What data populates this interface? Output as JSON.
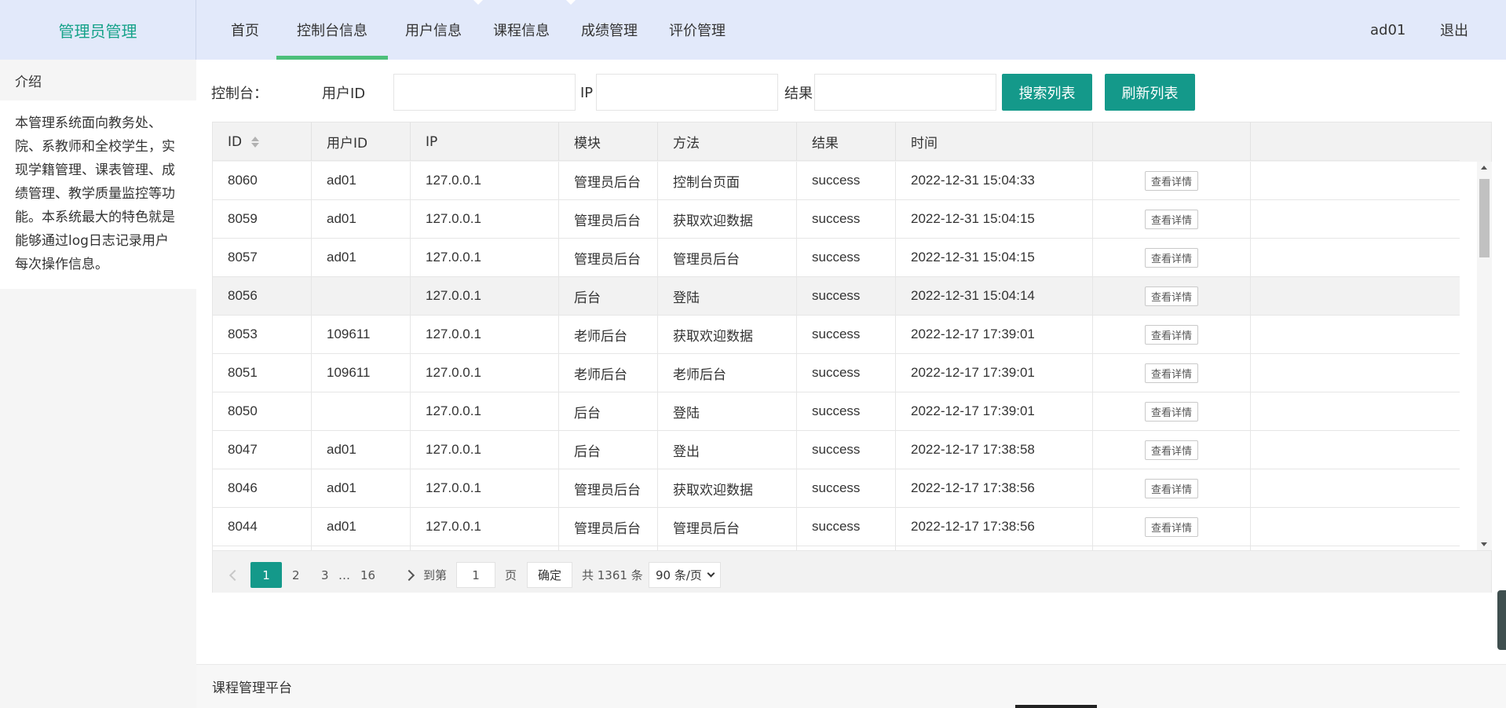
{
  "header": {
    "brand": "管理员管理",
    "nav": [
      "首页",
      "控制台信息",
      "用户信息",
      "课程信息",
      "成绩管理",
      "评价管理"
    ],
    "active_nav": "控制台信息",
    "user": "ad01",
    "logout": "退出"
  },
  "sidebar": {
    "title": "介绍",
    "text": "本管理系统面向教务处、院、系教师和全校学生，实现学籍管理、课表管理、成绩管理、教学质量监控等功能。本系统最大的特色就是能够通过log日志记录用户每次操作信息。"
  },
  "search": {
    "prefix": "控制台：",
    "user_id_label": "用户ID",
    "ip_label": "IP",
    "result_label": "结果",
    "user_id_value": "",
    "ip_value": "",
    "result_value": "",
    "search_button": "搜索列表",
    "refresh_button": "刷新列表"
  },
  "table": {
    "headers": [
      "ID",
      "用户ID",
      "IP",
      "模块",
      "方法",
      "结果",
      "时间",
      ""
    ],
    "action_label": "查看详情",
    "rows": [
      {
        "id": "8060",
        "user": "ad01",
        "ip": "127.0.0.1",
        "module": "管理员后台",
        "method": "控制台页面",
        "result": "success",
        "time": "2022-12-31 15:04:33"
      },
      {
        "id": "8059",
        "user": "ad01",
        "ip": "127.0.0.1",
        "module": "管理员后台",
        "method": "获取欢迎数据",
        "result": "success",
        "time": "2022-12-31 15:04:15"
      },
      {
        "id": "8057",
        "user": "ad01",
        "ip": "127.0.0.1",
        "module": "管理员后台",
        "method": "管理员后台",
        "result": "success",
        "time": "2022-12-31 15:04:15"
      },
      {
        "id": "8056",
        "user": "",
        "ip": "127.0.0.1",
        "module": "后台",
        "method": "登陆",
        "result": "success",
        "time": "2022-12-31 15:04:14"
      },
      {
        "id": "8053",
        "user": "109611",
        "ip": "127.0.0.1",
        "module": "老师后台",
        "method": "获取欢迎数据",
        "result": "success",
        "time": "2022-12-17 17:39:01"
      },
      {
        "id": "8051",
        "user": "109611",
        "ip": "127.0.0.1",
        "module": "老师后台",
        "method": "老师后台",
        "result": "success",
        "time": "2022-12-17 17:39:01"
      },
      {
        "id": "8050",
        "user": "",
        "ip": "127.0.0.1",
        "module": "后台",
        "method": "登陆",
        "result": "success",
        "time": "2022-12-17 17:39:01"
      },
      {
        "id": "8047",
        "user": "ad01",
        "ip": "127.0.0.1",
        "module": "后台",
        "method": "登出",
        "result": "success",
        "time": "2022-12-17 17:38:58"
      },
      {
        "id": "8046",
        "user": "ad01",
        "ip": "127.0.0.1",
        "module": "管理员后台",
        "method": "获取欢迎数据",
        "result": "success",
        "time": "2022-12-17 17:38:56"
      },
      {
        "id": "8044",
        "user": "ad01",
        "ip": "127.0.0.1",
        "module": "管理员后台",
        "method": "管理员后台",
        "result": "success",
        "time": "2022-12-17 17:38:56"
      },
      {
        "id": "",
        "user": "",
        "ip": "",
        "module": "",
        "method": "",
        "result": "",
        "time": ""
      }
    ]
  },
  "pager": {
    "pages": [
      "1",
      "2",
      "3"
    ],
    "ellipsis": "…",
    "last_page": "16",
    "goto_label": "到第",
    "goto_value": "1",
    "page_unit": "页",
    "confirm": "确定",
    "total": "共 1361 条",
    "page_size": "90 条/页"
  },
  "footer": {
    "text": "课程管理平台"
  }
}
